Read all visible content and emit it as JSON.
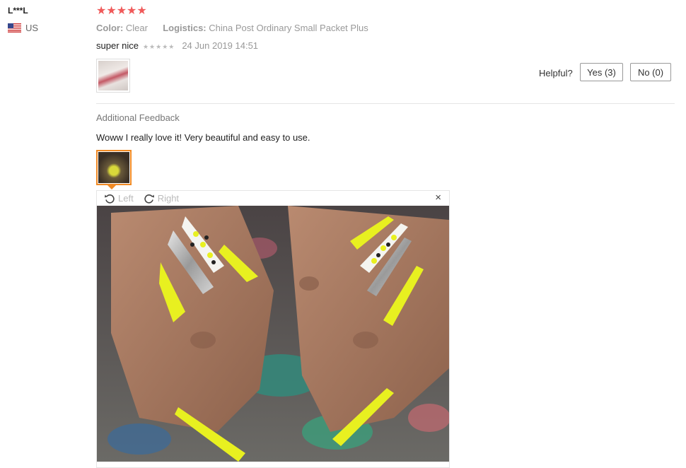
{
  "reviewer": {
    "name": "L***L",
    "country": "US"
  },
  "review": {
    "rating_stars": "★★★★★",
    "color_label": "Color:",
    "color_value": "Clear",
    "logistics_label": "Logistics:",
    "logistics_value": "China Post Ordinary Small Packet Plus",
    "comment": "super nice",
    "mini_stars": "★★★★★",
    "date": "24 Jun 2019 14:51"
  },
  "helpful": {
    "label": "Helpful?",
    "yes": "Yes (3)",
    "no": "No (0)"
  },
  "additional": {
    "title": "Additional Feedback",
    "text": "Woww I really love it! Very beautiful and easy to use."
  },
  "viewer": {
    "rotate_left": "Left",
    "rotate_right": "Right",
    "close": "×"
  },
  "colors": {
    "star": "#f05a5a",
    "accent": "#f08a24",
    "neon_nail": "#e8f020"
  },
  "icons": [
    "us-flag-icon",
    "rotate-left-icon",
    "rotate-right-icon",
    "close-icon"
  ]
}
